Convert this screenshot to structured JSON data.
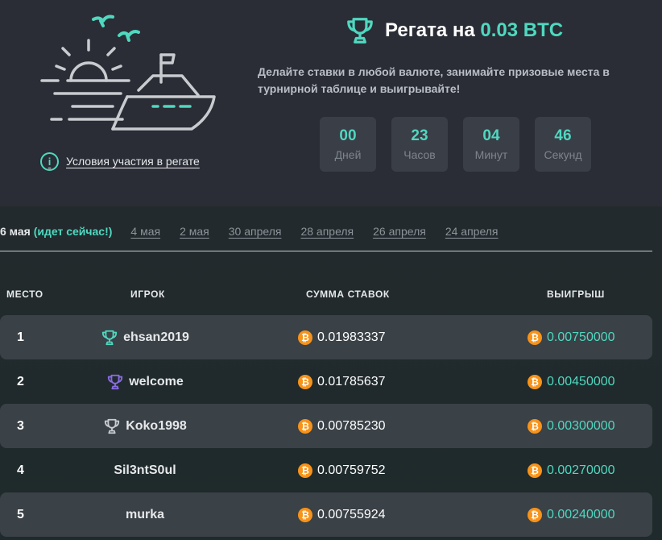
{
  "colors": {
    "accent": "#4fd8c0",
    "gold_cup": "#4fd8c0",
    "silver_cup": "#8a6ce6",
    "bronze_cup": "#c8ccd0",
    "bitcoin": "#f7931a"
  },
  "header": {
    "title_prefix": "Регата на ",
    "title_accent": "0.03 BTC",
    "subtitle": "Делайте ставки в любой валюте, занимайте призовые места в турнирной таблице и выигрывайте!",
    "rules_link": "Условия участия в регате",
    "info_icon_glyph": "i"
  },
  "countdown": [
    {
      "value": "00",
      "label": "Дней"
    },
    {
      "value": "23",
      "label": "Часов"
    },
    {
      "value": "04",
      "label": "Минут"
    },
    {
      "value": "46",
      "label": "Секунд"
    }
  ],
  "dates": {
    "current": "6 мая",
    "current_status": "(идет сейчас!)",
    "past": [
      "4 мая",
      "2 мая",
      "30 апреля",
      "28 апреля",
      "26 апреля",
      "24 апреля"
    ]
  },
  "table": {
    "headers": {
      "place": "МЕСТО",
      "player": "ИГРОК",
      "sum": "СУММА СТАВОК",
      "win": "ВЫИГРЫШ"
    },
    "currency_glyph": "₿",
    "rows": [
      {
        "place": "1",
        "player": "ehsan2019",
        "cup": "gold",
        "sum": "0.01983337",
        "win": "0.00750000"
      },
      {
        "place": "2",
        "player": "welcome",
        "cup": "silver",
        "sum": "0.01785637",
        "win": "0.00450000"
      },
      {
        "place": "3",
        "player": "Koko1998",
        "cup": "bronze",
        "sum": "0.00785230",
        "win": "0.00300000"
      },
      {
        "place": "4",
        "player": "Sil3ntS0ul",
        "cup": "",
        "sum": "0.00759752",
        "win": "0.00270000"
      },
      {
        "place": "5",
        "player": "murka",
        "cup": "",
        "sum": "0.00755924",
        "win": "0.00240000"
      }
    ]
  }
}
